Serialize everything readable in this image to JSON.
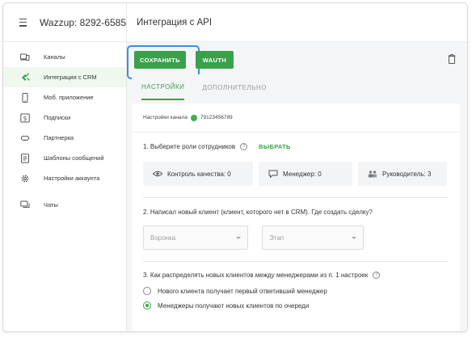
{
  "sidebar": {
    "title": "Wazzup: 8292-6585",
    "items": [
      {
        "label": "Каналы",
        "icon": "tablet-phone-icon"
      },
      {
        "label": "Интеграция с CRM",
        "icon": "puzzle-icon",
        "active": true
      },
      {
        "label": "Моб. приложение",
        "icon": "smartphone-icon"
      },
      {
        "label": "Подписки",
        "icon": "dollar-icon"
      },
      {
        "label": "Партнерка",
        "icon": "handshake-icon"
      },
      {
        "label": "Шаблоны сообщений",
        "icon": "document-icon"
      },
      {
        "label": "Настройки аккаунта",
        "icon": "gear-icon"
      },
      {
        "label": "Чаты",
        "icon": "chat-icon"
      }
    ]
  },
  "main": {
    "title": "Интеграция с API",
    "toolbar": {
      "save_label": "СОХРАНИТЬ",
      "wauth_label": "WAUTH"
    },
    "tabs": [
      {
        "label": "НАСТРОЙКИ",
        "active": true
      },
      {
        "label": "ДОПОЛНИТЕЛЬНО",
        "active": false
      }
    ],
    "channel": {
      "label": "Настройки канала",
      "phone": "79123456789"
    },
    "roles_section": {
      "question": "1. Выберите роли сотрудников",
      "help": "?",
      "link": "ВЫБРАТЬ",
      "roles": [
        {
          "label": "Контроль качества: 0",
          "icon": "eye-icon"
        },
        {
          "label": "Менеджер: 0",
          "icon": "chat-bubble-icon"
        },
        {
          "label": "Руководитель: 3",
          "icon": "team-icon"
        }
      ]
    },
    "deal_section": {
      "question": "2. Написал новый клиент (клиент, которого нет в CRM). Где создать сделку?",
      "funnel_placeholder": "Воронка",
      "stage_placeholder": "Этап"
    },
    "distribution_section": {
      "question": "3. Как распределять новых клиентов между менеджерами из п. 1 настроек",
      "help": "?",
      "options": [
        {
          "label": "Нового клиента получает первый ответивший менеджер",
          "selected": false
        },
        {
          "label": "Менеджеры получают новых клиентов по очереди",
          "selected": true
        }
      ]
    }
  },
  "colors": {
    "accent": "#39a14a",
    "focus": "#3a8ee6",
    "sidebar_active_bg": "#eef8ee"
  }
}
